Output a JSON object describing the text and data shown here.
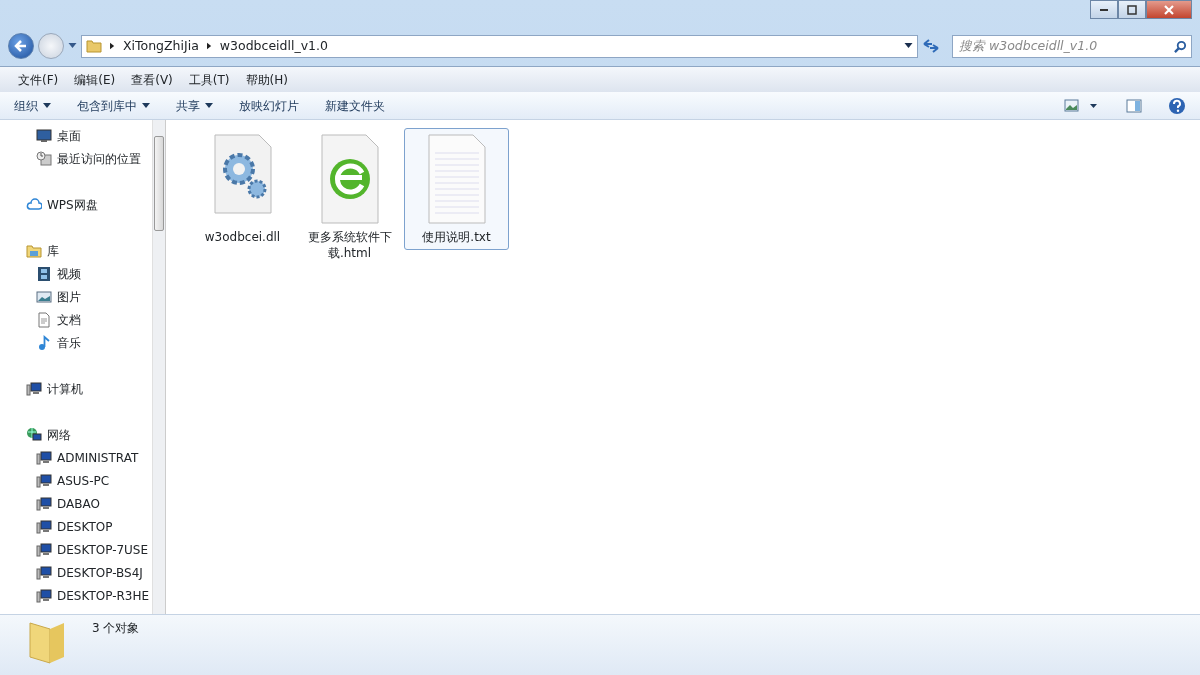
{
  "address_bar": {
    "path": [
      "XiTongZhiJia",
      "w3odbceidll_v1.0"
    ]
  },
  "search": {
    "placeholder": "搜索 w3odbceidll_v1.0"
  },
  "menu": [
    "文件(F)",
    "编辑(E)",
    "查看(V)",
    "工具(T)",
    "帮助(H)"
  ],
  "toolbar": [
    {
      "label": "组织",
      "dropdown": true
    },
    {
      "label": "包含到库中",
      "dropdown": true
    },
    {
      "label": "共享",
      "dropdown": true
    },
    {
      "label": "放映幻灯片",
      "dropdown": false
    },
    {
      "label": "新建文件夹",
      "dropdown": false
    }
  ],
  "navigation": [
    {
      "children": [
        {
          "label": "桌面",
          "kind": "desktop"
        },
        {
          "label": "最近访问的位置",
          "kind": "recent"
        }
      ]
    },
    {
      "label": "WPS网盘",
      "kind": "cloud"
    },
    {
      "label": "库",
      "kind": "library",
      "children": [
        {
          "label": "视频",
          "kind": "video"
        },
        {
          "label": "图片",
          "kind": "picture"
        },
        {
          "label": "文档",
          "kind": "document"
        },
        {
          "label": "音乐",
          "kind": "music"
        }
      ]
    },
    {
      "label": "计算机",
      "kind": "computer"
    },
    {
      "label": "网络",
      "kind": "network",
      "children": [
        {
          "label": "ADMINISTRAT",
          "kind": "computer"
        },
        {
          "label": "ASUS-PC",
          "kind": "computer"
        },
        {
          "label": "DABAO",
          "kind": "computer"
        },
        {
          "label": "DESKTOP",
          "kind": "computer"
        },
        {
          "label": "DESKTOP-7USE",
          "kind": "computer"
        },
        {
          "label": "DESKTOP-BS4J",
          "kind": "computer"
        },
        {
          "label": "DESKTOP-R3HE",
          "kind": "computer"
        }
      ]
    }
  ],
  "files": [
    {
      "name": "w3odbcei.dll",
      "kind": "dll",
      "selected": false
    },
    {
      "name": "更多系统软件下载.html",
      "kind": "html",
      "selected": false
    },
    {
      "name": "使用说明.txt",
      "kind": "txt",
      "selected": true
    }
  ],
  "status_bar": {
    "text": "3 个对象"
  }
}
